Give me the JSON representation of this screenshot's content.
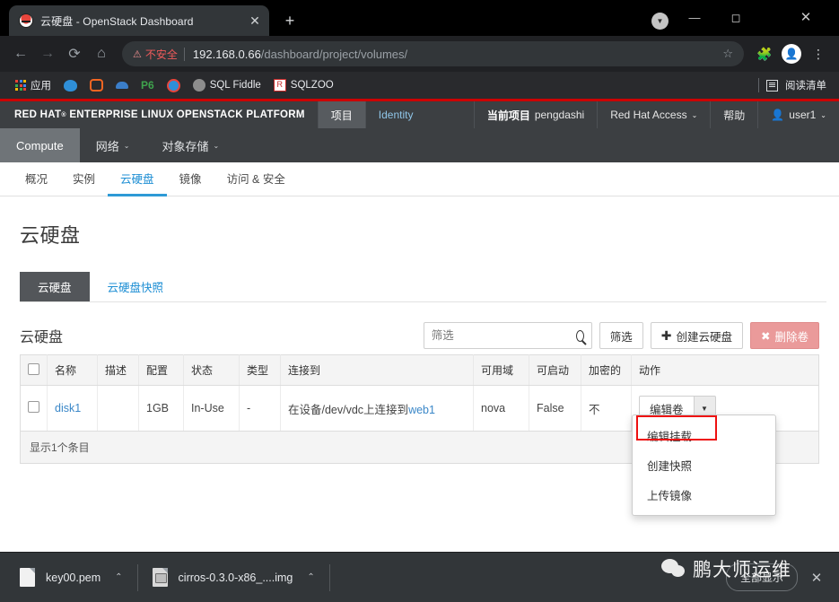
{
  "browser": {
    "tab_title": "云硬盘 - OpenStack Dashboard",
    "tab_close": "✕",
    "new_tab": "+",
    "minimize": "—",
    "maximize": "◻",
    "close": "✕",
    "back": "←",
    "forward": "→",
    "reload": "⟳",
    "home": "⌂",
    "warning_icon": "⚠",
    "warning_text": "不安全",
    "url_host": "192.168.0.66",
    "url_path": "/dashboard/project/volumes/",
    "star": "☆",
    "extensions_icon": "🧩",
    "avatar_icon": "👤",
    "menu_icon": "⋮",
    "bookmarks": [
      {
        "label": "应用",
        "icon": "apps-grid-icon"
      },
      {
        "label": "",
        "icon": "blue-mask-icon"
      },
      {
        "label": "",
        "icon": "orange-bracket-icon"
      },
      {
        "label": "",
        "icon": "blue-wave-icon"
      },
      {
        "label": "",
        "icon": "p6-icon"
      },
      {
        "label": "",
        "icon": "browser-globe-icon"
      },
      {
        "label": "SQL Fiddle",
        "icon": "gray-burst-icon"
      },
      {
        "label": "SQLZOO",
        "icon": "red-badge-icon"
      }
    ],
    "reading_list": "阅读清单"
  },
  "openstack": {
    "brand": "RED HAT",
    "brand_sup": "®",
    "brand_rest": "ENTERPRISE LINUX OPENSTACK PLATFORM",
    "top_tabs": [
      {
        "label": "项目",
        "active": true
      },
      {
        "label": "Identity",
        "active": false
      }
    ],
    "current_project_label": "当前项目",
    "current_project_name": "pengdashi",
    "redhat_access": "Red Hat Access",
    "help": "帮助",
    "user": "user1",
    "caret": "⌄",
    "subnav": [
      {
        "label": "Compute",
        "active": true,
        "caret": false
      },
      {
        "label": "网络",
        "active": false,
        "caret": true
      },
      {
        "label": "对象存储",
        "active": false,
        "caret": true
      }
    ],
    "page_tabs": [
      {
        "label": "概况",
        "active": false
      },
      {
        "label": "实例",
        "active": false
      },
      {
        "label": "云硬盘",
        "active": true
      },
      {
        "label": "镜像",
        "active": false
      },
      {
        "label": "访问 & 安全",
        "active": false
      }
    ],
    "page_title": "云硬盘",
    "sub_tabs": [
      {
        "label": "云硬盘",
        "active": true
      },
      {
        "label": "云硬盘快照",
        "active": false
      }
    ],
    "panel_title": "云硬盘",
    "search_placeholder": "筛选",
    "search_value": "",
    "filter_button": "筛选",
    "create_button": "创建云硬盘",
    "create_plus": "✚",
    "delete_button": "删除卷",
    "delete_x": "✖",
    "table": {
      "headers": [
        "名称",
        "描述",
        "配置",
        "状态",
        "类型",
        "连接到",
        "可用域",
        "可启动",
        "加密的",
        "动作"
      ],
      "rows": [
        {
          "name": "disk1",
          "description": "",
          "size": "1GB",
          "status": "In-Use",
          "type": "-",
          "attached_prefix": "在设备/dev/vdc上连接到",
          "attached_link": "web1",
          "zone": "nova",
          "bootable": "False",
          "encrypted": "不",
          "action_label": "编辑卷"
        }
      ],
      "footer": "显示1个条目"
    },
    "action_menu": [
      {
        "label": "编辑挂载",
        "highlighted": false
      },
      {
        "label": "创建快照",
        "highlighted": true
      },
      {
        "label": "上传镜像",
        "highlighted": false
      }
    ]
  },
  "downloads": {
    "items": [
      {
        "name": "key00.pem",
        "icon": "file-icon"
      },
      {
        "name": "cirros-0.3.0-x86_....img",
        "icon": "image-file-icon"
      }
    ],
    "caret": "⌃",
    "show_all": "全部显示",
    "close": "✕"
  },
  "watermark": {
    "text": "鹏大师运维"
  },
  "colors": {
    "accent_blue": "#1f8fd4",
    "brand_red": "#cc0000",
    "danger": "#ea9a9a",
    "annotation_red": "#ee1111",
    "header_dark": "#3c3f42"
  }
}
